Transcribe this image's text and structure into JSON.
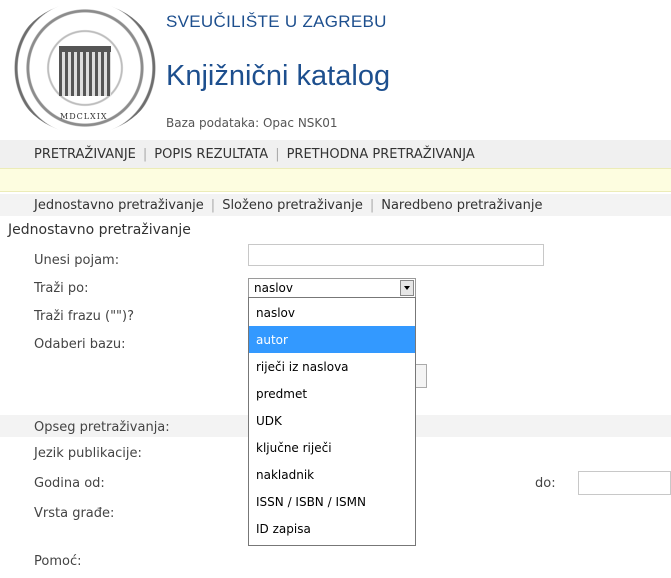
{
  "header": {
    "university": "SVEUČILIŠTE U ZAGREBU",
    "catalog_title": "Knjižnični katalog",
    "database_line": "Baza podataka: Opac NSK01",
    "seal_text": "MDCLXIX"
  },
  "main_nav": [
    "PRETRAŽIVANJE",
    "POPIS REZULTATA",
    "PRETHODNA PRETRAŽIVANJA"
  ],
  "sub_nav": [
    "Jednostavno pretraživanje",
    "Složeno pretraživanje",
    "Naredbeno pretraživanje"
  ],
  "form": {
    "section_title": "Jednostavno pretraživanje",
    "term_label": "Unesi pojam:",
    "term_value": "",
    "search_by_label": "Traži po:",
    "search_by_value": "naslov",
    "phrase_label": "Traži frazu (\"\")?",
    "database_label": "Odaberi bazu:",
    "scope_label": "Opseg pretraživanja:",
    "language_label": "Jezik publikacije:",
    "year_from_label": "Godina od:",
    "year_to_label": "do:",
    "material_label": "Vrsta građe:",
    "help_label": "Pomoć:"
  },
  "dropdown": {
    "options": [
      "naslov",
      "autor",
      "riječi iz naslova",
      "predmet",
      "UDK",
      "ključne riječi",
      "nakladnik",
      "ISSN / ISBN / ISMN",
      "ID zapisa"
    ],
    "highlighted": "autor"
  },
  "colors": {
    "title_blue": "#1d4f8e",
    "highlight": "#3399ff",
    "notice_bar": "#fdfde0"
  }
}
